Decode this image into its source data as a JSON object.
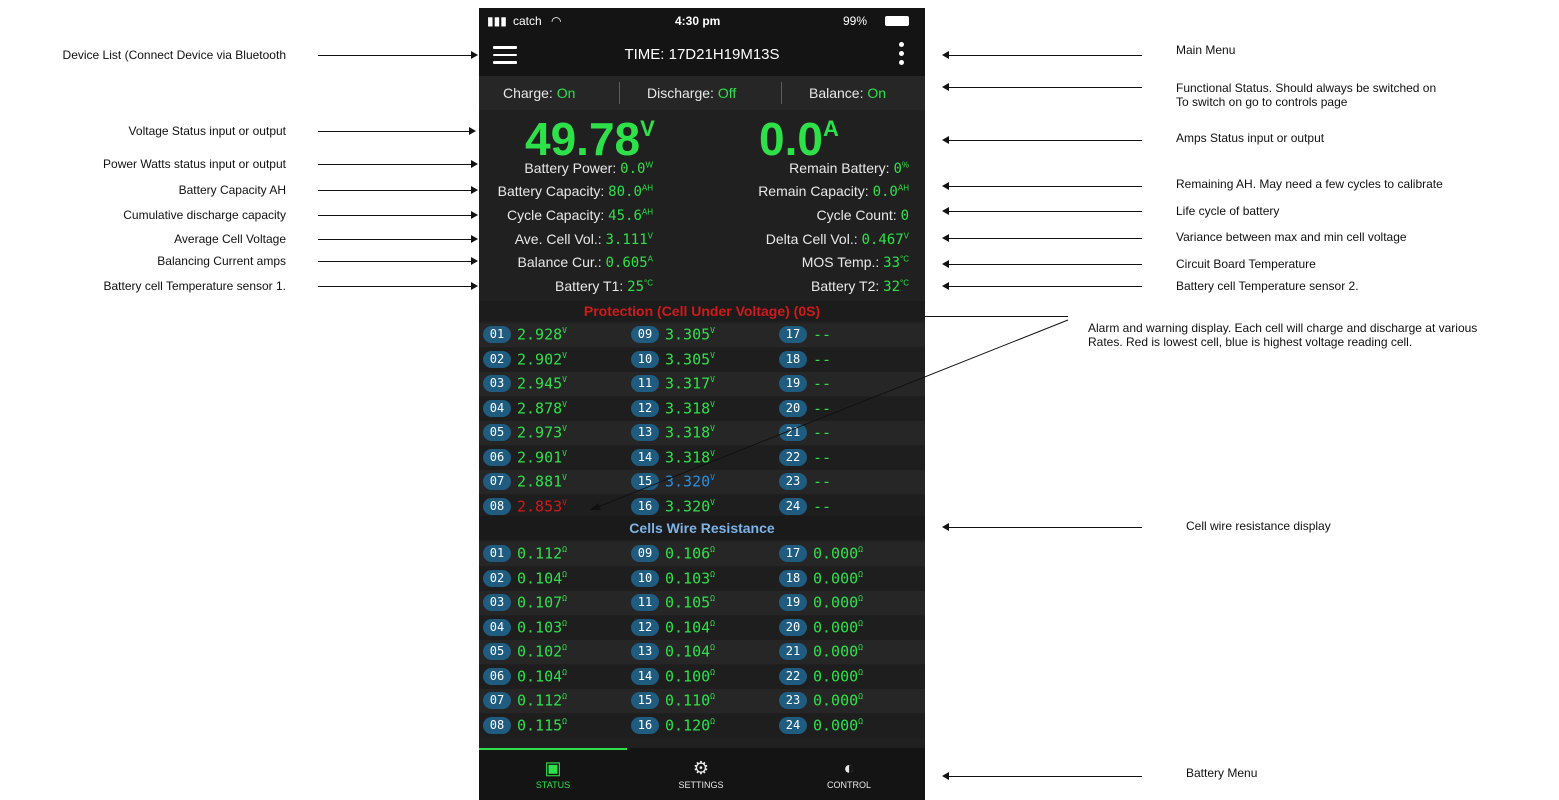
{
  "phone": {
    "status_bar": {
      "carrier": "catch",
      "time": "4:30 pm",
      "battery": "99%"
    },
    "header": {
      "title": "TIME: 17D21H19M13S"
    },
    "functional": [
      {
        "label": "Charge:",
        "value": "On"
      },
      {
        "label": "Discharge:",
        "value": "Off"
      },
      {
        "label": "Balance:",
        "value": "On"
      }
    ],
    "voltage": {
      "value": "49.78",
      "unit": "V"
    },
    "amps": {
      "value": "0.0",
      "unit": "A"
    },
    "stats": [
      {
        "label": "Battery Power:",
        "value": "0.0",
        "unit": "W"
      },
      {
        "label": "Remain Battery:",
        "value": "0",
        "unit": "%"
      },
      {
        "label": "Battery Capacity:",
        "value": "80.0",
        "unit": "AH"
      },
      {
        "label": "Remain Capacity:",
        "value": "0.0",
        "unit": "AH"
      },
      {
        "label": "Cycle Capacity:",
        "value": "45.6",
        "unit": "AH"
      },
      {
        "label": "Cycle Count:",
        "value": "0",
        "unit": ""
      },
      {
        "label": "Ave. Cell Vol.:",
        "value": "3.111",
        "unit": "V"
      },
      {
        "label": "Delta Cell Vol.:",
        "value": "0.467",
        "unit": "V"
      },
      {
        "label": "Balance Cur.:",
        "value": "0.605",
        "unit": "A"
      },
      {
        "label": "MOS Temp.:",
        "value": "33",
        "unit": "°C"
      },
      {
        "label": "Battery T1:",
        "value": "25",
        "unit": "°C"
      },
      {
        "label": "Battery T2:",
        "value": "32",
        "unit": "°C"
      }
    ],
    "protection_text": "Protection (Cell Under Voltage) (0S)",
    "cells": [
      {
        "idx": "01",
        "val": "2.928",
        "unit": "V",
        "state": "normal"
      },
      {
        "idx": "02",
        "val": "2.902",
        "unit": "V",
        "state": "normal"
      },
      {
        "idx": "03",
        "val": "2.945",
        "unit": "V",
        "state": "normal"
      },
      {
        "idx": "04",
        "val": "2.878",
        "unit": "V",
        "state": "normal"
      },
      {
        "idx": "05",
        "val": "2.973",
        "unit": "V",
        "state": "normal"
      },
      {
        "idx": "06",
        "val": "2.901",
        "unit": "V",
        "state": "normal"
      },
      {
        "idx": "07",
        "val": "2.881",
        "unit": "V",
        "state": "normal"
      },
      {
        "idx": "08",
        "val": "2.853",
        "unit": "V",
        "state": "lowest"
      },
      {
        "idx": "09",
        "val": "3.305",
        "unit": "V",
        "state": "normal"
      },
      {
        "idx": "10",
        "val": "3.305",
        "unit": "V",
        "state": "normal"
      },
      {
        "idx": "11",
        "val": "3.317",
        "unit": "V",
        "state": "normal"
      },
      {
        "idx": "12",
        "val": "3.318",
        "unit": "V",
        "state": "normal"
      },
      {
        "idx": "13",
        "val": "3.318",
        "unit": "V",
        "state": "normal"
      },
      {
        "idx": "14",
        "val": "3.318",
        "unit": "V",
        "state": "normal"
      },
      {
        "idx": "15",
        "val": "3.320",
        "unit": "V",
        "state": "highest"
      },
      {
        "idx": "16",
        "val": "3.320",
        "unit": "V",
        "state": "normal"
      },
      {
        "idx": "17",
        "val": "--",
        "unit": "",
        "state": "normal"
      },
      {
        "idx": "18",
        "val": "--",
        "unit": "",
        "state": "normal"
      },
      {
        "idx": "19",
        "val": "--",
        "unit": "",
        "state": "normal"
      },
      {
        "idx": "20",
        "val": "--",
        "unit": "",
        "state": "normal"
      },
      {
        "idx": "21",
        "val": "--",
        "unit": "",
        "state": "normal"
      },
      {
        "idx": "22",
        "val": "--",
        "unit": "",
        "state": "normal"
      },
      {
        "idx": "23",
        "val": "--",
        "unit": "",
        "state": "normal"
      },
      {
        "idx": "24",
        "val": "--",
        "unit": "",
        "state": "normal"
      }
    ],
    "resistance_title": "Cells Wire Resistance",
    "resistances": [
      {
        "idx": "01",
        "val": "0.112",
        "unit": "Ω"
      },
      {
        "idx": "02",
        "val": "0.104",
        "unit": "Ω"
      },
      {
        "idx": "03",
        "val": "0.107",
        "unit": "Ω"
      },
      {
        "idx": "04",
        "val": "0.103",
        "unit": "Ω"
      },
      {
        "idx": "05",
        "val": "0.102",
        "unit": "Ω"
      },
      {
        "idx": "06",
        "val": "0.104",
        "unit": "Ω"
      },
      {
        "idx": "07",
        "val": "0.112",
        "unit": "Ω"
      },
      {
        "idx": "08",
        "val": "0.115",
        "unit": "Ω"
      },
      {
        "idx": "09",
        "val": "0.106",
        "unit": "Ω"
      },
      {
        "idx": "10",
        "val": "0.103",
        "unit": "Ω"
      },
      {
        "idx": "11",
        "val": "0.105",
        "unit": "Ω"
      },
      {
        "idx": "12",
        "val": "0.104",
        "unit": "Ω"
      },
      {
        "idx": "13",
        "val": "0.104",
        "unit": "Ω"
      },
      {
        "idx": "14",
        "val": "0.100",
        "unit": "Ω"
      },
      {
        "idx": "15",
        "val": "0.110",
        "unit": "Ω"
      },
      {
        "idx": "16",
        "val": "0.120",
        "unit": "Ω"
      },
      {
        "idx": "17",
        "val": "0.000",
        "unit": "Ω"
      },
      {
        "idx": "18",
        "val": "0.000",
        "unit": "Ω"
      },
      {
        "idx": "19",
        "val": "0.000",
        "unit": "Ω"
      },
      {
        "idx": "20",
        "val": "0.000",
        "unit": "Ω"
      },
      {
        "idx": "21",
        "val": "0.000",
        "unit": "Ω"
      },
      {
        "idx": "22",
        "val": "0.000",
        "unit": "Ω"
      },
      {
        "idx": "23",
        "val": "0.000",
        "unit": "Ω"
      },
      {
        "idx": "24",
        "val": "0.000",
        "unit": "Ω"
      }
    ],
    "tabs": [
      {
        "label": "STATUS",
        "icon": "monitor-icon",
        "active": true
      },
      {
        "label": "SETTINGS",
        "icon": "gear-icon",
        "active": false
      },
      {
        "label": "CONTROL",
        "icon": "toggle-icon",
        "active": false
      }
    ]
  },
  "annotations_left": [
    "Device List (Connect Device via Bluetooth",
    "Voltage Status input or output",
    "Power Watts status input or output",
    "Battery Capacity AH",
    "Cumulative discharge capacity",
    "Average Cell Voltage",
    "Balancing Current amps",
    "Battery cell Temperature sensor 1."
  ],
  "annotations_right": [
    "Main Menu",
    "Functional Status. Should always be switched on\nTo switch on go to controls page",
    "Amps Status input or output",
    "Remaining AH. May need a few cycles to calibrate",
    "Life cycle of battery",
    "Variance between max and min cell voltage",
    "Circuit Board Temperature",
    "Battery cell Temperature sensor 2.",
    "Alarm and warning display. Each cell will charge and discharge at various\nRates. Red is lowest cell, blue is highest voltage reading cell.",
    "Cell wire resistance display",
    "Battery Menu"
  ],
  "colors": {
    "accent_green": "#2ee14a",
    "alarm_red": "#d11a1a",
    "highest_blue": "#2a8fe0",
    "index_badge": "#1f5c80"
  }
}
